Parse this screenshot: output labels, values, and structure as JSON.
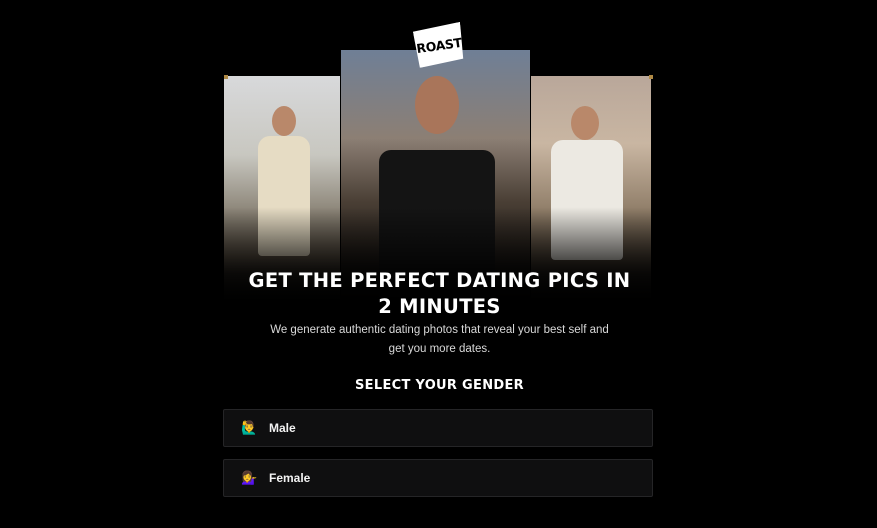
{
  "logo": {
    "text": "ROAST"
  },
  "hero": {
    "headline_line1": "GET THE PERFECT DATING PICS IN",
    "headline_line2": "2 MINUTES",
    "subtitle_line1": "We generate authentic dating photos that reveal your best self and",
    "subtitle_line2": "get you more dates."
  },
  "gender": {
    "label": "SELECT YOUR GENDER",
    "options": [
      {
        "label": "Male",
        "icon": "man-raising-hand-icon"
      },
      {
        "label": "Female",
        "icon": "woman-tipping-hand-icon"
      }
    ]
  },
  "colors": {
    "background": "#000000",
    "option_bg": "#0f0f10",
    "option_border": "#252527",
    "accent_gold": "#b08a45"
  }
}
